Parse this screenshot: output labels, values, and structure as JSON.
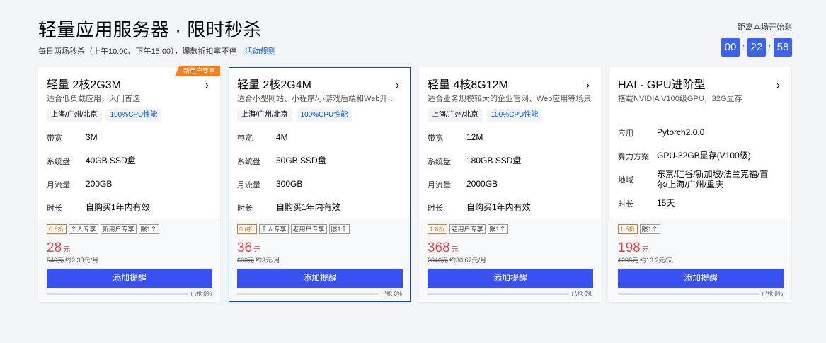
{
  "header": {
    "title": "轻量应用服务器 · 限时秒杀",
    "subtitle": "每日两场秒杀（上午10:00、下午15:00），爆款折扣享不停",
    "rules_link": "活动规则"
  },
  "countdown": {
    "label": "距离本场开始剩",
    "hours": "00",
    "minutes": "22",
    "seconds": "58",
    "sep": ":"
  },
  "colors": {
    "accent": "#3a51f2",
    "price": "#e54545",
    "discount": "#e37318",
    "tag_blue": "#0052d9"
  },
  "cards": [
    {
      "title": "轻量 2核2G3M",
      "desc": "适合低负载应用，入门首选",
      "tags": [
        "上海/广州/北京",
        "100%CPU性能"
      ],
      "new_user_tag": "新用户专享",
      "specs": [
        {
          "k": "带宽",
          "v": "3M"
        },
        {
          "k": "系统盘",
          "v": "40GB SSD盘"
        },
        {
          "k": "月流量",
          "v": "200GB"
        },
        {
          "k": "时长",
          "v": "自购买1年内有效"
        }
      ],
      "badges": [
        "0.5折",
        "个人专享",
        "新用户专享",
        "限1个"
      ],
      "price": "28",
      "yuan": "元",
      "orig": "540元",
      "per_unit": "约2.33元/月",
      "button": "添加提醒",
      "sold": "已抢 0%",
      "sold_fraction": 0
    },
    {
      "title": "轻量 2核2G4M",
      "desc": "适合小型网站、小程序/小游戏后端和Web开发场景",
      "tags": [
        "上海/广州/北京",
        "100%CPU性能"
      ],
      "specs": [
        {
          "k": "带宽",
          "v": "4M"
        },
        {
          "k": "系统盘",
          "v": "50GB SSD盘"
        },
        {
          "k": "月流量",
          "v": "300GB"
        },
        {
          "k": "时长",
          "v": "自购买1年内有效"
        }
      ],
      "badges": [
        "0.6折",
        "个人专享",
        "老用户专享",
        "限1个"
      ],
      "price": "36",
      "yuan": "元",
      "orig": "600元",
      "per_unit": "约3元/月",
      "button": "添加提醒",
      "sold": "已抢 0%",
      "sold_fraction": 0
    },
    {
      "title": "轻量 4核8G12M",
      "desc": "适合业务规模较大的企业官网、Web应用等场景",
      "tags": [
        "上海/广州/北京",
        "100%CPU性能"
      ],
      "specs": [
        {
          "k": "带宽",
          "v": "12M"
        },
        {
          "k": "系统盘",
          "v": "180GB SSD盘"
        },
        {
          "k": "月流量",
          "v": "2000GB"
        },
        {
          "k": "时长",
          "v": "自购买1年内有效"
        }
      ],
      "badges": [
        "1.8折",
        "老用户专享",
        "限1个"
      ],
      "price": "368",
      "yuan": "元",
      "orig": "2040元",
      "per_unit": "约30.67元/月",
      "button": "添加提醒",
      "sold": "已抢 0%",
      "sold_fraction": 0
    },
    {
      "title": "HAI - GPU进阶型",
      "desc": "搭载NVIDIA V100级GPU，32G显存",
      "specs": [
        {
          "k": "应用",
          "v": "Pytorch2.0.0"
        },
        {
          "k": "算力方案",
          "v": "GPU-32GB显存(V100级)"
        },
        {
          "k": "地域",
          "v": "东京/硅谷/新加坡/法兰克福/首尔/上海/广州/重庆"
        },
        {
          "k": "时长",
          "v": "15天"
        }
      ],
      "badges": [
        "1.5折",
        "限1个"
      ],
      "price": "198",
      "yuan": "元",
      "orig": "1208元",
      "per_unit": "约13.2元/天",
      "button": "添加提醒",
      "sold": "已抢 0%",
      "sold_fraction": 0
    }
  ]
}
